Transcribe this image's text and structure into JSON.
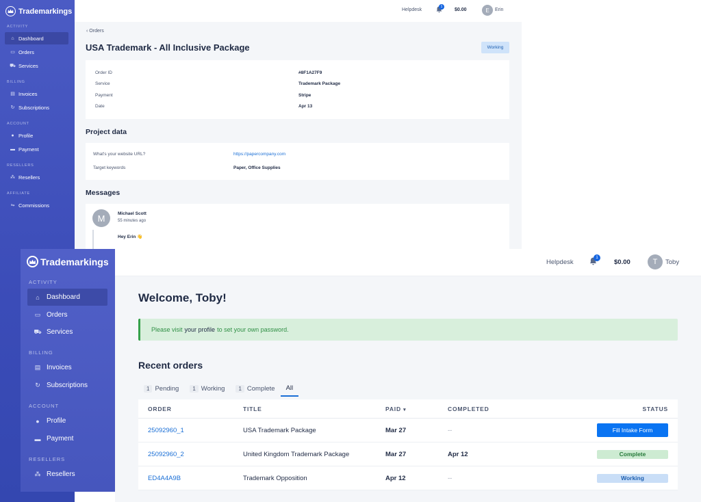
{
  "brand": {
    "name": "Trademarkings",
    "logo_icon": "crown-icon"
  },
  "sidebar": {
    "sections": {
      "activity": "ACTIVITY",
      "billing": "BILLING",
      "account": "ACCOUNT",
      "resellers": "RESELLERS",
      "affiliate": "AFFILIATE"
    },
    "items": {
      "dashboard": "Dashboard",
      "orders": "Orders",
      "services": "Services",
      "invoices": "Invoices",
      "subscriptions": "Subscriptions",
      "profile": "Profile",
      "payment": "Payment",
      "resellers": "Resellers",
      "commissions": "Commissions"
    }
  },
  "back_window": {
    "topbar": {
      "helpdesk": "Helpdesk",
      "notifications": "1",
      "balance": "$0.00",
      "avatar_initial": "E",
      "user": "Erin"
    },
    "breadcrumb": "Orders",
    "title": "USA Trademark - All Inclusive Package",
    "status": "Working",
    "order_info": {
      "order_id_label": "Order ID",
      "order_id": "#8F1A27F9",
      "service_label": "Service",
      "service": "Trademark Package",
      "payment_label": "Payment",
      "payment": "Stripe",
      "date_label": "Date",
      "date": "Apr 13"
    },
    "project_heading": "Project data",
    "project": {
      "website_label": "What's your website URL?",
      "website": "https://papercompany.com",
      "keywords_label": "Target keywords",
      "keywords": "Paper, Office Supplies"
    },
    "messages_heading": "Messages",
    "message": {
      "avatar_initial": "M",
      "author": "Michael Scott",
      "time": "55 minutes ago",
      "text": "Hey Erin 👋"
    }
  },
  "front_window": {
    "topbar": {
      "helpdesk": "Helpdesk",
      "notifications": "1",
      "balance": "$0.00",
      "avatar_initial": "T",
      "user": "Toby"
    },
    "welcome": "Welcome, Toby!",
    "alert": {
      "before": "Please visit",
      "link": "your profile",
      "after": "to set your own password."
    },
    "recent_heading": "Recent orders",
    "tabs": [
      {
        "count": "1",
        "label": "Pending"
      },
      {
        "count": "1",
        "label": "Working"
      },
      {
        "count": "1",
        "label": "Complete"
      },
      {
        "count": "",
        "label": "All"
      }
    ],
    "columns": {
      "order": "ORDER",
      "title": "TITLE",
      "paid": "PAID",
      "completed": "COMPLETED",
      "status": "STATUS"
    },
    "orders": [
      {
        "id": "25092960_1",
        "title": "USA Trademark Package",
        "paid": "Mar 27",
        "completed": "--",
        "status": "Fill Intake Form"
      },
      {
        "id": "25092960_2",
        "title": "United Kingdom Trademark Package",
        "paid": "Mar 27",
        "completed": "Apr 12",
        "status": "Complete"
      },
      {
        "id": "ED4A4A9B",
        "title": "Trademark Opposition",
        "paid": "Apr 12",
        "completed": "--",
        "status": "Working"
      }
    ]
  },
  "colors": {
    "sidebar": "#4b5bc4",
    "accent": "#1a6fd6",
    "success": "#35a14a",
    "page_bg": "#f4f6f9"
  }
}
